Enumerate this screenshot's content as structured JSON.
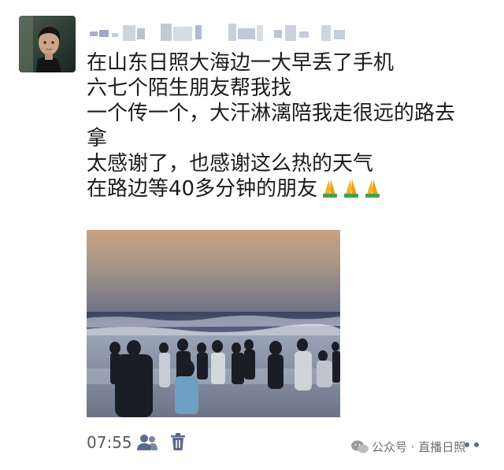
{
  "post": {
    "lines": [
      "在山东日照大海边一大早丢了手机",
      "六七个陌生朋友帮我找",
      "一个传一个，大汗淋漓陪我走很远的路去",
      "拿",
      "太感谢了，也感谢这么热的天气",
      "在路边等40多分钟的朋友"
    ],
    "emoji_icon": "folded-hands-emoji",
    "emoji_count": 3,
    "photo_subject": "beach-sunrise-people"
  },
  "footer": {
    "time": "07:55",
    "visibility_icon": "people-icon",
    "delete_icon": "trash-icon",
    "more_icon": "more-dots-icon"
  },
  "watermark": {
    "text": "公众号 · 直播日照",
    "logo_icon": "wechat-logo-icon"
  },
  "colors": {
    "text": "#1b1b1b",
    "secondary": "#5a5a5a",
    "link_icon": "#5a6a8a",
    "sky_top": "#c9a486",
    "sea": "#3f4a62"
  }
}
